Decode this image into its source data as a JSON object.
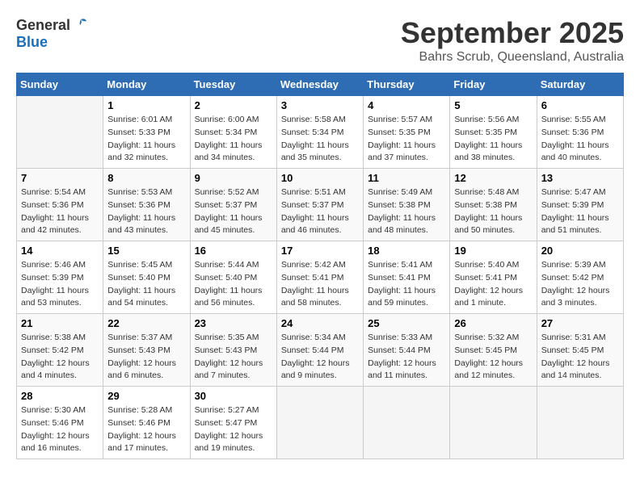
{
  "logo": {
    "general": "General",
    "blue": "Blue"
  },
  "title": "September 2025",
  "location": "Bahrs Scrub, Queensland, Australia",
  "days_of_week": [
    "Sunday",
    "Monday",
    "Tuesday",
    "Wednesday",
    "Thursday",
    "Friday",
    "Saturday"
  ],
  "weeks": [
    [
      {
        "num": "",
        "info": ""
      },
      {
        "num": "1",
        "info": "Sunrise: 6:01 AM\nSunset: 5:33 PM\nDaylight: 11 hours\nand 32 minutes."
      },
      {
        "num": "2",
        "info": "Sunrise: 6:00 AM\nSunset: 5:34 PM\nDaylight: 11 hours\nand 34 minutes."
      },
      {
        "num": "3",
        "info": "Sunrise: 5:58 AM\nSunset: 5:34 PM\nDaylight: 11 hours\nand 35 minutes."
      },
      {
        "num": "4",
        "info": "Sunrise: 5:57 AM\nSunset: 5:35 PM\nDaylight: 11 hours\nand 37 minutes."
      },
      {
        "num": "5",
        "info": "Sunrise: 5:56 AM\nSunset: 5:35 PM\nDaylight: 11 hours\nand 38 minutes."
      },
      {
        "num": "6",
        "info": "Sunrise: 5:55 AM\nSunset: 5:36 PM\nDaylight: 11 hours\nand 40 minutes."
      }
    ],
    [
      {
        "num": "7",
        "info": "Sunrise: 5:54 AM\nSunset: 5:36 PM\nDaylight: 11 hours\nand 42 minutes."
      },
      {
        "num": "8",
        "info": "Sunrise: 5:53 AM\nSunset: 5:36 PM\nDaylight: 11 hours\nand 43 minutes."
      },
      {
        "num": "9",
        "info": "Sunrise: 5:52 AM\nSunset: 5:37 PM\nDaylight: 11 hours\nand 45 minutes."
      },
      {
        "num": "10",
        "info": "Sunrise: 5:51 AM\nSunset: 5:37 PM\nDaylight: 11 hours\nand 46 minutes."
      },
      {
        "num": "11",
        "info": "Sunrise: 5:49 AM\nSunset: 5:38 PM\nDaylight: 11 hours\nand 48 minutes."
      },
      {
        "num": "12",
        "info": "Sunrise: 5:48 AM\nSunset: 5:38 PM\nDaylight: 11 hours\nand 50 minutes."
      },
      {
        "num": "13",
        "info": "Sunrise: 5:47 AM\nSunset: 5:39 PM\nDaylight: 11 hours\nand 51 minutes."
      }
    ],
    [
      {
        "num": "14",
        "info": "Sunrise: 5:46 AM\nSunset: 5:39 PM\nDaylight: 11 hours\nand 53 minutes."
      },
      {
        "num": "15",
        "info": "Sunrise: 5:45 AM\nSunset: 5:40 PM\nDaylight: 11 hours\nand 54 minutes."
      },
      {
        "num": "16",
        "info": "Sunrise: 5:44 AM\nSunset: 5:40 PM\nDaylight: 11 hours\nand 56 minutes."
      },
      {
        "num": "17",
        "info": "Sunrise: 5:42 AM\nSunset: 5:41 PM\nDaylight: 11 hours\nand 58 minutes."
      },
      {
        "num": "18",
        "info": "Sunrise: 5:41 AM\nSunset: 5:41 PM\nDaylight: 11 hours\nand 59 minutes."
      },
      {
        "num": "19",
        "info": "Sunrise: 5:40 AM\nSunset: 5:41 PM\nDaylight: 12 hours\nand 1 minute."
      },
      {
        "num": "20",
        "info": "Sunrise: 5:39 AM\nSunset: 5:42 PM\nDaylight: 12 hours\nand 3 minutes."
      }
    ],
    [
      {
        "num": "21",
        "info": "Sunrise: 5:38 AM\nSunset: 5:42 PM\nDaylight: 12 hours\nand 4 minutes."
      },
      {
        "num": "22",
        "info": "Sunrise: 5:37 AM\nSunset: 5:43 PM\nDaylight: 12 hours\nand 6 minutes."
      },
      {
        "num": "23",
        "info": "Sunrise: 5:35 AM\nSunset: 5:43 PM\nDaylight: 12 hours\nand 7 minutes."
      },
      {
        "num": "24",
        "info": "Sunrise: 5:34 AM\nSunset: 5:44 PM\nDaylight: 12 hours\nand 9 minutes."
      },
      {
        "num": "25",
        "info": "Sunrise: 5:33 AM\nSunset: 5:44 PM\nDaylight: 12 hours\nand 11 minutes."
      },
      {
        "num": "26",
        "info": "Sunrise: 5:32 AM\nSunset: 5:45 PM\nDaylight: 12 hours\nand 12 minutes."
      },
      {
        "num": "27",
        "info": "Sunrise: 5:31 AM\nSunset: 5:45 PM\nDaylight: 12 hours\nand 14 minutes."
      }
    ],
    [
      {
        "num": "28",
        "info": "Sunrise: 5:30 AM\nSunset: 5:46 PM\nDaylight: 12 hours\nand 16 minutes."
      },
      {
        "num": "29",
        "info": "Sunrise: 5:28 AM\nSunset: 5:46 PM\nDaylight: 12 hours\nand 17 minutes."
      },
      {
        "num": "30",
        "info": "Sunrise: 5:27 AM\nSunset: 5:47 PM\nDaylight: 12 hours\nand 19 minutes."
      },
      {
        "num": "",
        "info": ""
      },
      {
        "num": "",
        "info": ""
      },
      {
        "num": "",
        "info": ""
      },
      {
        "num": "",
        "info": ""
      }
    ]
  ]
}
